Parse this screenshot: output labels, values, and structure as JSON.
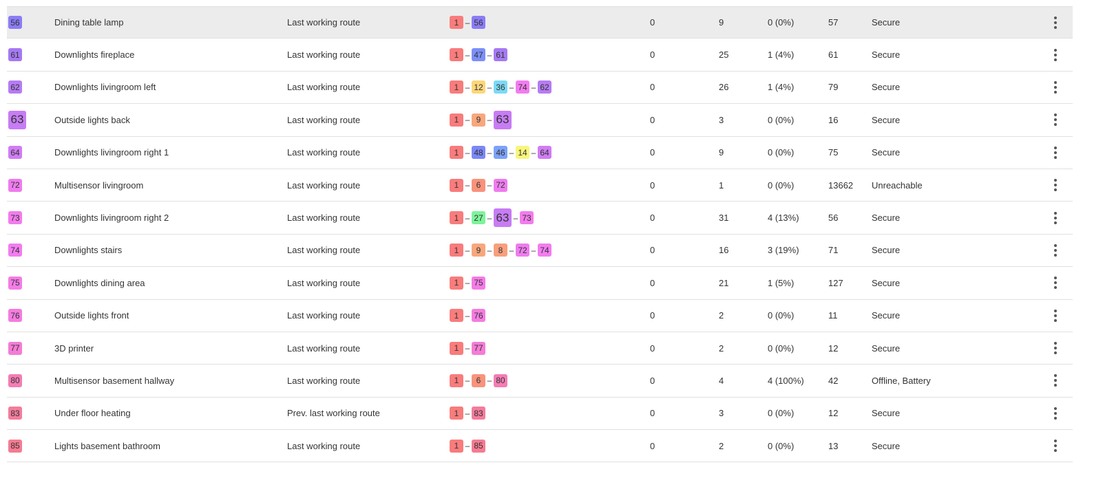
{
  "rows": [
    {
      "id": "56",
      "id_color": "#8b7cf6",
      "name": "Dining table lamp",
      "route": "Last working route",
      "path": [
        {
          "n": "1",
          "c": "#f87c7c"
        },
        {
          "n": "56",
          "c": "#8b7cf6"
        }
      ],
      "a": "0",
      "b": "9",
      "c": "0 (0%)",
      "d": "57",
      "status": "Secure",
      "highlight": true
    },
    {
      "id": "61",
      "id_color": "#a679f3",
      "name": "Downlights fireplace",
      "route": "Last working route",
      "path": [
        {
          "n": "1",
          "c": "#f87c7c"
        },
        {
          "n": "47",
          "c": "#7c8ff8"
        },
        {
          "n": "61",
          "c": "#a679f3"
        }
      ],
      "a": "0",
      "b": "25",
      "c": "1 (4%)",
      "d": "61",
      "status": "Secure"
    },
    {
      "id": "62",
      "id_color": "#b67cf4",
      "name": "Downlights livingroom left",
      "route": "Last working route",
      "path": [
        {
          "n": "1",
          "c": "#f87c7c"
        },
        {
          "n": "12",
          "c": "#fcd67a"
        },
        {
          "n": "36",
          "c": "#7cd9f4"
        },
        {
          "n": "74",
          "c": "#f27cf0"
        },
        {
          "n": "62",
          "c": "#b67cf4"
        }
      ],
      "a": "0",
      "b": "26",
      "c": "1 (4%)",
      "d": "79",
      "status": "Secure"
    },
    {
      "id": "63",
      "id_color": "#c77cf4",
      "big": true,
      "name": "Outside lights back",
      "route": "Last working route",
      "path": [
        {
          "n": "1",
          "c": "#f87c7c"
        },
        {
          "n": "9",
          "c": "#f8a77c"
        },
        {
          "n": "63",
          "c": "#c77cf4",
          "big": true
        }
      ],
      "a": "0",
      "b": "3",
      "c": "0 (0%)",
      "d": "16",
      "status": "Secure"
    },
    {
      "id": "64",
      "id_color": "#d07cf4",
      "name": "Downlights livingroom right 1",
      "route": "Last working route",
      "path": [
        {
          "n": "1",
          "c": "#f87c7c"
        },
        {
          "n": "48",
          "c": "#7c88f8"
        },
        {
          "n": "46",
          "c": "#7ca2f8"
        },
        {
          "n": "14",
          "c": "#f8f57c"
        },
        {
          "n": "64",
          "c": "#d07cf4"
        }
      ],
      "a": "0",
      "b": "9",
      "c": "0 (0%)",
      "d": "75",
      "status": "Secure"
    },
    {
      "id": "72",
      "id_color": "#ee7cee",
      "name": "Multisensor livingroom",
      "route": "Last working route",
      "path": [
        {
          "n": "1",
          "c": "#f87c7c"
        },
        {
          "n": "6",
          "c": "#f8937c"
        },
        {
          "n": "72",
          "c": "#ee7cee"
        }
      ],
      "a": "0",
      "b": "1",
      "c": "0 (0%)",
      "d": "13662",
      "status": "Unreachable"
    },
    {
      "id": "73",
      "id_color": "#f27cec",
      "name": "Downlights livingroom right 2",
      "route": "Last working route",
      "path": [
        {
          "n": "1",
          "c": "#f87c7c"
        },
        {
          "n": "27",
          "c": "#7cf49a"
        },
        {
          "n": "63",
          "c": "#c77cf4",
          "big": true
        },
        {
          "n": "73",
          "c": "#f27cec"
        }
      ],
      "a": "0",
      "b": "31",
      "c": "4 (13%)",
      "d": "56",
      "status": "Secure"
    },
    {
      "id": "74",
      "id_color": "#f27cf0",
      "name": "Downlights stairs",
      "route": "Last working route",
      "path": [
        {
          "n": "1",
          "c": "#f87c7c"
        },
        {
          "n": "9",
          "c": "#f8a77c"
        },
        {
          "n": "8",
          "c": "#f89f7c"
        },
        {
          "n": "72",
          "c": "#ee7cee"
        },
        {
          "n": "74",
          "c": "#f27cf0"
        }
      ],
      "a": "0",
      "b": "16",
      "c": "3 (19%)",
      "d": "71",
      "status": "Secure"
    },
    {
      "id": "75",
      "id_color": "#f47ce6",
      "name": "Downlights dining area",
      "route": "Last working route",
      "path": [
        {
          "n": "1",
          "c": "#f87c7c"
        },
        {
          "n": "75",
          "c": "#f47ce6"
        }
      ],
      "a": "0",
      "b": "21",
      "c": "1 (5%)",
      "d": "127",
      "status": "Secure"
    },
    {
      "id": "76",
      "id_color": "#f47ce0",
      "name": "Outside lights front",
      "route": "Last working route",
      "path": [
        {
          "n": "1",
          "c": "#f87c7c"
        },
        {
          "n": "76",
          "c": "#f47ce0"
        }
      ],
      "a": "0",
      "b": "2",
      "c": "0 (0%)",
      "d": "11",
      "status": "Secure"
    },
    {
      "id": "77",
      "id_color": "#f47cd6",
      "name": "3D printer",
      "route": "Last working route",
      "path": [
        {
          "n": "1",
          "c": "#f87c7c"
        },
        {
          "n": "77",
          "c": "#f47cd6"
        }
      ],
      "a": "0",
      "b": "2",
      "c": "0 (0%)",
      "d": "12",
      "status": "Secure"
    },
    {
      "id": "80",
      "id_color": "#f47cb4",
      "name": "Multisensor basement hallway",
      "route": "Last working route",
      "path": [
        {
          "n": "1",
          "c": "#f87c7c"
        },
        {
          "n": "6",
          "c": "#f8937c"
        },
        {
          "n": "80",
          "c": "#f47cb4"
        }
      ],
      "a": "0",
      "b": "4",
      "c": "4 (100%)",
      "d": "42",
      "status": "Offline, Battery"
    },
    {
      "id": "83",
      "id_color": "#f47c9c",
      "name": "Under floor heating",
      "route": "Prev. last working route",
      "path": [
        {
          "n": "1",
          "c": "#f87c7c"
        },
        {
          "n": "83",
          "c": "#f47c9c"
        }
      ],
      "a": "0",
      "b": "3",
      "c": "0 (0%)",
      "d": "12",
      "status": "Secure"
    },
    {
      "id": "85",
      "id_color": "#f47c92",
      "name": "Lights basement bathroom",
      "route": "Last working route",
      "path": [
        {
          "n": "1",
          "c": "#f87c7c"
        },
        {
          "n": "85",
          "c": "#f47c92"
        }
      ],
      "a": "0",
      "b": "2",
      "c": "0 (0%)",
      "d": "13",
      "status": "Secure"
    }
  ],
  "separator": "–",
  "menu_icon": "more-vert-icon"
}
